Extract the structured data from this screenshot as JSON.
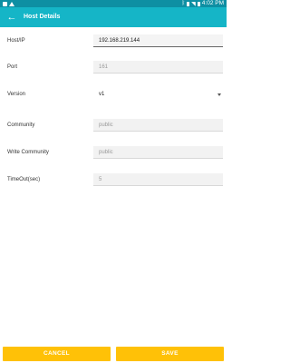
{
  "status_bar": {
    "time": "4:02 PM",
    "left_icons": [
      "image-icon",
      "warning-icon"
    ],
    "right_icons": [
      "bluetooth-icon",
      "vibrate-icon",
      "wifi-icon",
      "battery-icon"
    ]
  },
  "app_bar": {
    "title": "Host Details",
    "back_icon": "arrow-back-icon",
    "color": "#15b5c7"
  },
  "form": {
    "host": {
      "label": "Host/IP",
      "value": "192.168.219.144"
    },
    "port": {
      "label": "Port",
      "placeholder": "161"
    },
    "version": {
      "label": "Version",
      "value": "v1"
    },
    "community": {
      "label": "Community",
      "placeholder": "public"
    },
    "write_community": {
      "label": "Write Community",
      "placeholder": "public"
    },
    "timeout": {
      "label": "TimeOut(sec)",
      "placeholder": "5"
    }
  },
  "actions": {
    "cancel": "CANCEL",
    "save": "SAVE",
    "color": "#ffc107"
  }
}
